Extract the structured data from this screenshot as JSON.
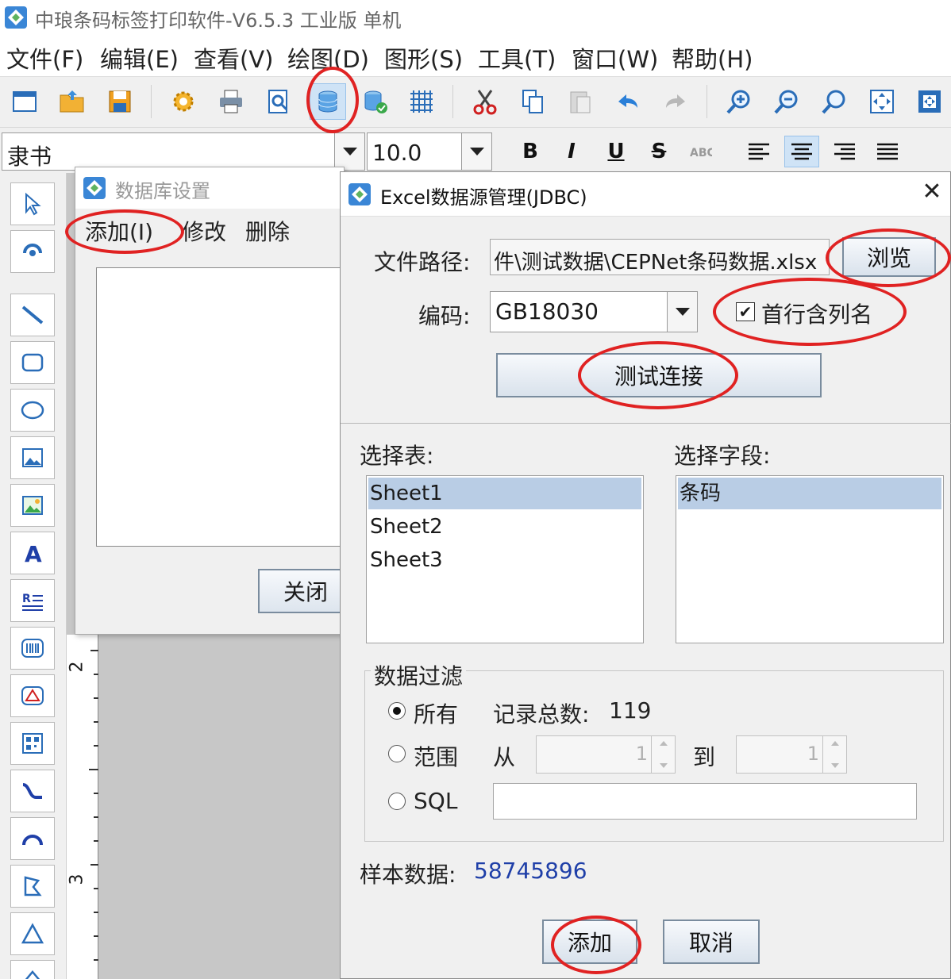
{
  "app": {
    "title": "中琅条码标签打印软件-V6.5.3 工业版 单机"
  },
  "menubar": [
    "文件(F)",
    "编辑(E)",
    "查看(V)",
    "绘图(D)",
    "图形(S)",
    "工具(T)",
    "窗口(W)",
    "帮助(H)"
  ],
  "toolbar": {
    "icons": [
      "new-icon",
      "open-icon",
      "save-icon",
      "settings-icon",
      "print-icon",
      "print-preview-icon",
      "database-icon",
      "data-connect-icon",
      "grid-icon",
      "cut-icon",
      "copy-icon",
      "paste-icon",
      "undo-icon",
      "redo-icon",
      "zoom-in-icon",
      "zoom-out-icon",
      "zoom-icon",
      "fit-page-icon",
      "fit-window-icon"
    ]
  },
  "fontbar": {
    "font": "隶书",
    "size": "10.0",
    "bold": "B",
    "italic": "I",
    "underline": "U",
    "strike": "S"
  },
  "db_dialog": {
    "title": "数据库设置",
    "menu_add": "添加(I)",
    "menu_edit": "修改",
    "menu_delete": "删除",
    "close_label": "关闭"
  },
  "excel_dialog": {
    "title": "Excel数据源管理(JDBC)",
    "path_label": "文件路径:",
    "path_value": "件\\测试数据\\CEPNet条码数据.xlsx",
    "browse_label": "浏览",
    "encoding_label": "编码:",
    "encoding_value": "GB18030",
    "header_checkbox_label": "首行含列名",
    "header_checked": true,
    "test_label": "测试连接",
    "table_label": "选择表:",
    "tables": [
      "Sheet1",
      "Sheet2",
      "Sheet3"
    ],
    "field_label": "选择字段:",
    "fields": [
      "条码"
    ],
    "filter_title": "数据过滤",
    "filter_all": "所有",
    "total_label": "记录总数:",
    "total_value": "119",
    "filter_range": "范围",
    "range_from_label": "从",
    "range_from": "1",
    "range_to_label": "到",
    "range_to": "1",
    "filter_sql": "SQL",
    "sample_label": "样本数据:",
    "sample_value": "58745896",
    "add_label": "添加",
    "cancel_label": "取消"
  },
  "colors": {
    "annotation": "#e02222",
    "accent_link": "#1f3fa8",
    "selected_row": "#b9cde5"
  },
  "ruler": {
    "marks": [
      "2",
      "3"
    ]
  }
}
